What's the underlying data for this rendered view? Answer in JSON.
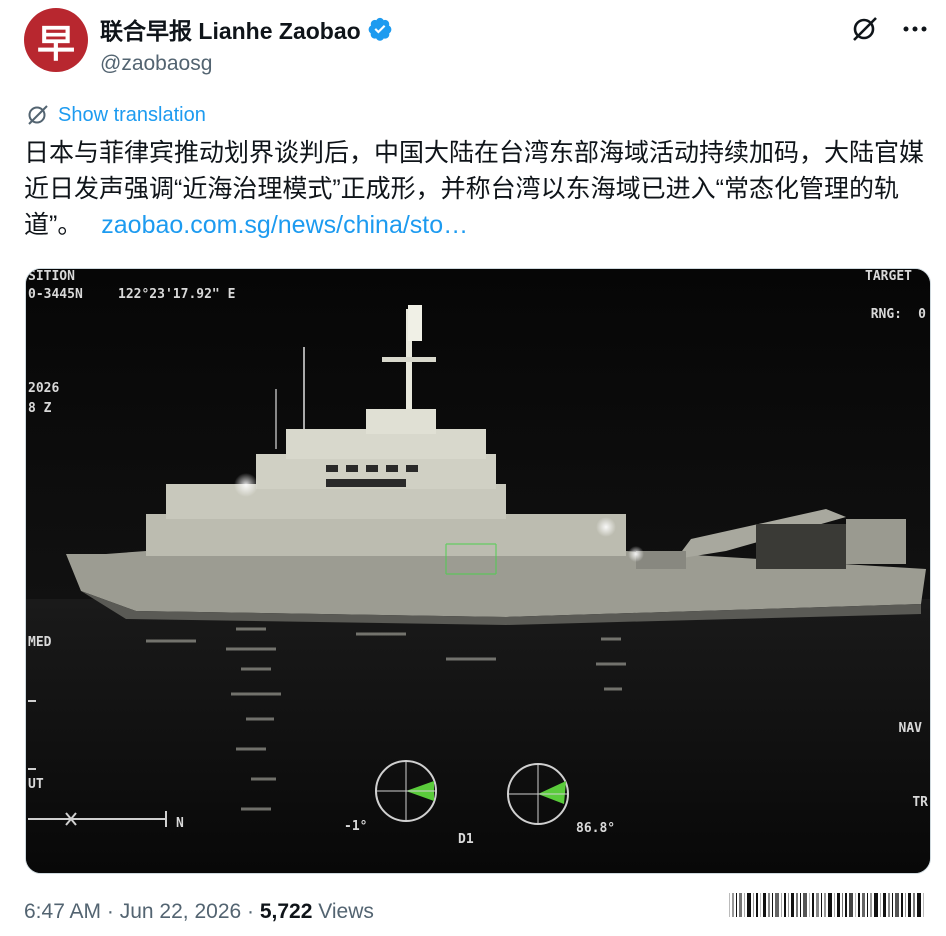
{
  "author": {
    "avatar_glyph": "早",
    "display_name": "联合早报 Lianhe Zaobao",
    "handle": "@zaobaosg",
    "verified": true,
    "avatar_color": "#b8272f"
  },
  "actions": {
    "grok_icon": "grok-icon",
    "more_icon": "more-icon"
  },
  "translation": {
    "label": "Show translation",
    "icon": "translate-icon"
  },
  "tweet": {
    "text": "日本与菲律宾推动划界谈判后，中国大陆在台湾东部海域活动持续加码，大陆官媒近日发声强调“近海治理模式”正成形，并称台湾以东海域已进入“常态化管理的轨道”。",
    "link": "zaobao.com.sg/news/china/sto…"
  },
  "media": {
    "hud": {
      "position_label": "SITION",
      "position_lat": "0-3445N",
      "position_lon": "122°23'17.92\" E",
      "year": "2026",
      "zone": "8 Z",
      "target_label": "TARGET",
      "rng_label": "RNG:",
      "rng_value": "0",
      "med_label": "MED",
      "out_label": "UT",
      "n_label": "N",
      "nav_label": "NAV",
      "tr_label": "TR",
      "left_bearing": "-1°",
      "d1_label": "D1",
      "right_bearing": "86.8°"
    }
  },
  "footer": {
    "time": "6:47 AM",
    "date": "Jun 22, 2026",
    "views_count": "5,722",
    "views_label": "Views"
  },
  "colors": {
    "link": "#1d9bf0",
    "secondary": "#536471"
  }
}
